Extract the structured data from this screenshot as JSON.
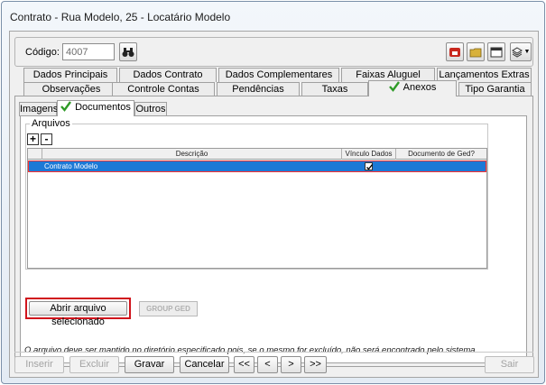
{
  "window": {
    "title": "Contrato - Rua Modelo, 25 - Locatário Modelo"
  },
  "code": {
    "label": "Código:",
    "value": "4007"
  },
  "toolbar_icons": [
    "binoculars-icon",
    "phone-icon",
    "folder-icon",
    "window-icon",
    "layers-icon",
    "chevron-down-icon"
  ],
  "tabs_row1": [
    "Dados Principais",
    "Dados Contrato",
    "Dados Complementares",
    "Faixas Aluguel",
    "Lançamentos Extras"
  ],
  "tabs_row2": [
    "Observações",
    "Controle Contas",
    "Pendências",
    "Taxas",
    "Anexos",
    "Tipo Garantia"
  ],
  "active_tab": "Anexos",
  "subtabs": [
    "Imagens",
    "Documentos",
    "Outros"
  ],
  "active_subtab": "Documentos",
  "arquivos": {
    "legend": "Arquivos",
    "add_label": "+",
    "remove_label": "-",
    "columns": [
      "Descrição",
      "Vínculo Dados",
      "Documento de Ged?"
    ],
    "rows": [
      {
        "descricao": "Contrato Modelo",
        "vinculo": true,
        "ged": false
      }
    ]
  },
  "open_button": "Abrir arquivo selecionado",
  "ged_button": "GROUP GED",
  "warning": "O arquivo deve ser mantido no diretório especificado pois, se o mesmo for excluído, não será encontrado pelo sistema.",
  "bottom": {
    "inserir": "Inserir",
    "excluir": "Excluir",
    "gravar": "Gravar",
    "cancelar": "Cancelar",
    "first": "<<",
    "prev": "<",
    "next": ">",
    "last": ">>",
    "sair": "Sair"
  },
  "colors": {
    "selection": "#1c79d6",
    "highlight_border": "#d0141c",
    "check": "#2e9a26"
  }
}
